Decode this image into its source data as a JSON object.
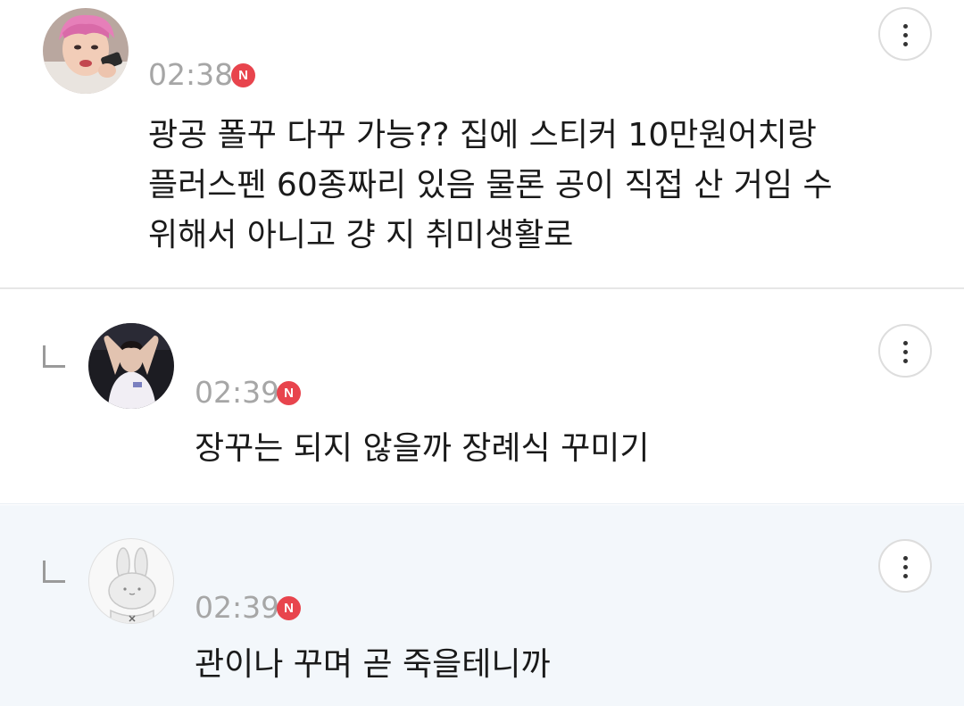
{
  "comments": [
    {
      "time": "02:38",
      "badge": "N",
      "lines": [
        "광공 폴꾸 다꾸 가능?? 집에 스티커 10만원어치랑",
        "플러스펜 60종짜리 있음 물론 공이 직접 산 거임 수",
        "위해서 아니고 걍 지 취미생활로"
      ],
      "avatar_icon": "user-avatar-pink-hair",
      "more_icon": "more-vertical-icon"
    },
    {
      "time": "02:39",
      "badge": "N",
      "lines": [
        "장꾸는 되지 않을까 장례식 꾸미기"
      ],
      "avatar_icon": "user-avatar-dark-photo",
      "reply_icon": "reply-indicator-icon",
      "more_icon": "more-vertical-icon"
    },
    {
      "time": "02:39",
      "badge": "N",
      "lines": [
        "관이나 꾸며 곧 죽을테니까"
      ],
      "avatar_icon": "default-bunny-avatar",
      "reply_icon": "reply-indicator-icon",
      "more_icon": "more-vertical-icon"
    }
  ],
  "colors": {
    "badge": "#e8444d",
    "time": "#a6a6a6",
    "text": "#1a1a1a",
    "reply_highlight_bg": "#f3f7fb"
  }
}
